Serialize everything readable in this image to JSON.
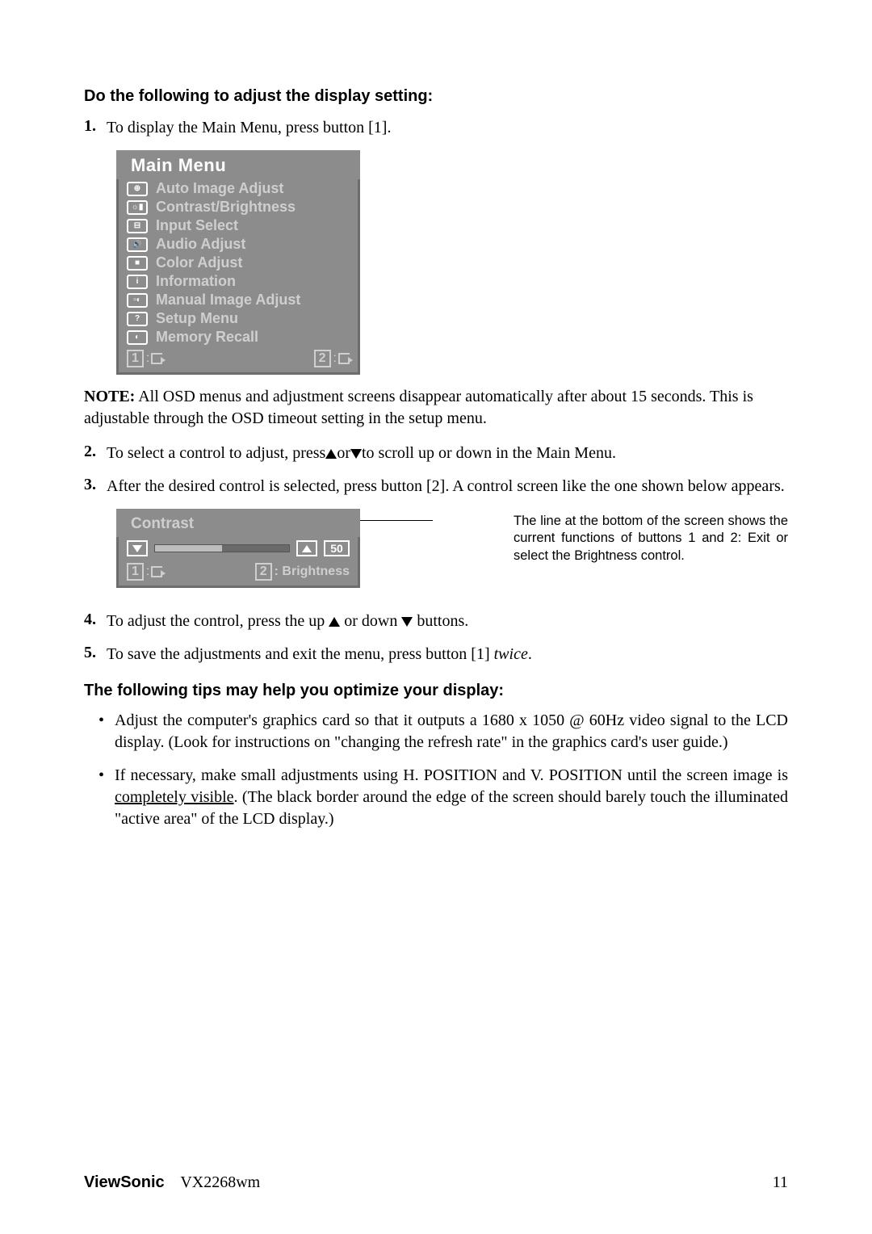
{
  "heading1": "Do the following to adjust the display setting:",
  "step1": {
    "num": "1.",
    "text": "To display the Main Menu, press button [1]."
  },
  "osdMain": {
    "title": "Main Menu",
    "items": [
      {
        "icon": "⊕",
        "label": "Auto Image Adjust"
      },
      {
        "icon": "☼▮",
        "label": "Contrast/Brightness"
      },
      {
        "icon": "⊟",
        "label": "Input Select"
      },
      {
        "icon": "🔊",
        "label": "Audio Adjust"
      },
      {
        "icon": "■",
        "label": "Color Adjust"
      },
      {
        "icon": "i",
        "label": "Information"
      },
      {
        "icon": "▫◐",
        "label": "Manual Image Adjust"
      },
      {
        "icon": "?",
        "label": "Setup Menu"
      },
      {
        "icon": "◐",
        "label": "Memory Recall"
      }
    ],
    "footer": {
      "btn1": "1",
      "btn2": "2"
    }
  },
  "noteLabel": "NOTE:",
  "noteText": " All OSD menus and adjustment screens disappear automatically after about 15 seconds. This is adjustable through the OSD timeout setting in the setup menu.",
  "step2": {
    "num": "2.",
    "pre": "To select a control to adjust, press",
    "mid": "or",
    "post": "to scroll up or down in the Main Menu."
  },
  "step3": {
    "num": "3.",
    "text": "After the desired control is selected, press button [2]. A control screen like the one shown below appears."
  },
  "osdContrast": {
    "title": "Contrast",
    "value": "50",
    "footer": {
      "btn1": "1",
      "btn2label": "2",
      "btn2text": ": Brightness"
    }
  },
  "annotation": "The line at the bottom of the screen shows the current functions of buttons 1 and 2: Exit or select the Brightness control.",
  "step4": {
    "num": "4.",
    "pre": "To adjust the control, press the up ",
    "mid": " or down ",
    "post": " buttons."
  },
  "step5": {
    "num": "5.",
    "pre": "To save the adjustments and exit the menu, press button [1] ",
    "italic": "twice",
    "post": "."
  },
  "heading2": "The following tips may help you optimize your display:",
  "bullet1": "Adjust the computer's graphics card so that it outputs a 1680 x 1050 @ 60Hz video signal to the LCD display. (Look for instructions on \"changing the refresh rate\" in the graphics card's user guide.)",
  "bullet2_pre": "If necessary, make small adjustments using H. POSITION and V. POSITION until the screen image is ",
  "bullet2_under": "completely visible",
  "bullet2_post": ". (The black border around the edge of the screen should barely touch the illuminated \"active area\" of the LCD display.)",
  "footer": {
    "brand": "ViewSonic",
    "model": "VX2268wm",
    "page": "11"
  }
}
